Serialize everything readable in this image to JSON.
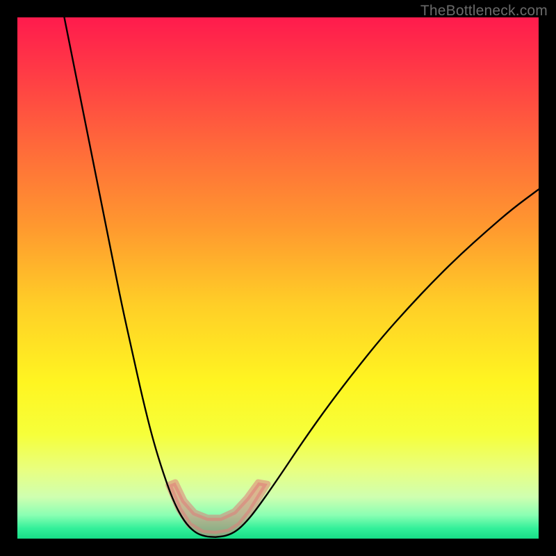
{
  "watermark": "TheBottleneck.com",
  "chart_data": {
    "type": "line",
    "title": "",
    "xlabel": "",
    "ylabel": "",
    "xlim": [
      0,
      100
    ],
    "ylim": [
      0,
      100
    ],
    "background_gradient_stops": [
      {
        "offset": 0.0,
        "color": "#ff1b4d"
      },
      {
        "offset": 0.1,
        "color": "#ff3946"
      },
      {
        "offset": 0.25,
        "color": "#ff6a3a"
      },
      {
        "offset": 0.4,
        "color": "#ff982f"
      },
      {
        "offset": 0.55,
        "color": "#ffce27"
      },
      {
        "offset": 0.7,
        "color": "#fff521"
      },
      {
        "offset": 0.8,
        "color": "#f6ff3a"
      },
      {
        "offset": 0.87,
        "color": "#e8ff82"
      },
      {
        "offset": 0.92,
        "color": "#cfffb0"
      },
      {
        "offset": 0.955,
        "color": "#8affb3"
      },
      {
        "offset": 0.98,
        "color": "#34f09a"
      },
      {
        "offset": 1.0,
        "color": "#17dd87"
      }
    ],
    "series": [
      {
        "name": "left-curve",
        "color": "#000000",
        "points": [
          {
            "x": 9.0,
            "y": 100.0
          },
          {
            "x": 10.0,
            "y": 95.0
          },
          {
            "x": 12.0,
            "y": 85.0
          },
          {
            "x": 14.0,
            "y": 75.0
          },
          {
            "x": 16.0,
            "y": 65.0
          },
          {
            "x": 18.0,
            "y": 55.0
          },
          {
            "x": 20.0,
            "y": 45.0
          },
          {
            "x": 22.0,
            "y": 36.0
          },
          {
            "x": 24.0,
            "y": 27.0
          },
          {
            "x": 26.0,
            "y": 19.0
          },
          {
            "x": 28.0,
            "y": 12.5
          },
          {
            "x": 30.0,
            "y": 7.0
          },
          {
            "x": 32.0,
            "y": 3.3
          },
          {
            "x": 34.0,
            "y": 1.2
          },
          {
            "x": 36.0,
            "y": 0.4
          },
          {
            "x": 38.0,
            "y": 0.3
          }
        ]
      },
      {
        "name": "right-curve",
        "color": "#000000",
        "points": [
          {
            "x": 38.0,
            "y": 0.3
          },
          {
            "x": 40.0,
            "y": 0.5
          },
          {
            "x": 42.0,
            "y": 1.4
          },
          {
            "x": 44.0,
            "y": 3.3
          },
          {
            "x": 46.0,
            "y": 5.8
          },
          {
            "x": 50.0,
            "y": 11.5
          },
          {
            "x": 55.0,
            "y": 19.0
          },
          {
            "x": 60.0,
            "y": 26.0
          },
          {
            "x": 65.0,
            "y": 32.5
          },
          {
            "x": 70.0,
            "y": 38.7
          },
          {
            "x": 75.0,
            "y": 44.3
          },
          {
            "x": 80.0,
            "y": 49.6
          },
          {
            "x": 85.0,
            "y": 54.5
          },
          {
            "x": 90.0,
            "y": 59.0
          },
          {
            "x": 95.0,
            "y": 63.3
          },
          {
            "x": 100.0,
            "y": 67.0
          }
        ]
      }
    ],
    "markers": [
      {
        "name": "pale-band",
        "type": "band",
        "color": "#e07b78",
        "opacity": 0.55,
        "polygon": [
          {
            "x": 29.0,
            "y": 10.3
          },
          {
            "x": 31.0,
            "y": 5.6
          },
          {
            "x": 33.0,
            "y": 2.6
          },
          {
            "x": 35.5,
            "y": 1.1
          },
          {
            "x": 38.0,
            "y": 0.9
          },
          {
            "x": 40.5,
            "y": 1.3
          },
          {
            "x": 42.6,
            "y": 2.6
          },
          {
            "x": 44.6,
            "y": 5.0
          },
          {
            "x": 46.2,
            "y": 7.6
          },
          {
            "x": 48.0,
            "y": 10.5
          },
          {
            "x": 46.2,
            "y": 10.8
          },
          {
            "x": 44.0,
            "y": 7.8
          },
          {
            "x": 41.6,
            "y": 5.2
          },
          {
            "x": 39.0,
            "y": 4.0
          },
          {
            "x": 36.5,
            "y": 4.0
          },
          {
            "x": 34.0,
            "y": 5.0
          },
          {
            "x": 32.0,
            "y": 7.3
          },
          {
            "x": 30.3,
            "y": 10.8
          }
        ]
      }
    ]
  }
}
